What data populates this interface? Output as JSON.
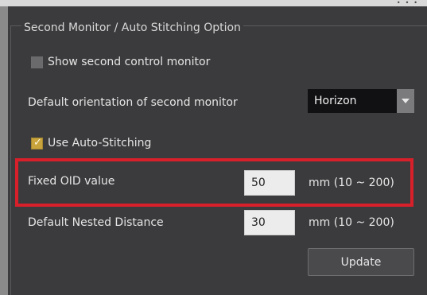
{
  "group": {
    "title": "Second Monitor / Auto Stitching Option"
  },
  "show_second_monitor": {
    "label": "Show second control monitor",
    "checked": false
  },
  "orientation": {
    "label": "Default orientation of second monitor",
    "selected": "Horizon"
  },
  "auto_stitching": {
    "label": "Use Auto-Stitching",
    "checked": true
  },
  "fixed_oid": {
    "label": "Fixed OID value",
    "value": "50",
    "unit": "mm (10 ~ 200)"
  },
  "nested_distance": {
    "label": "Default Nested Distance",
    "value": "30",
    "unit": "mm (10 ~ 200)"
  },
  "buttons": {
    "update": "Update"
  },
  "colors": {
    "panel_bg": "#3b3b3d",
    "highlight": "#d8202a",
    "checkbox_checked": "#c9a43c"
  },
  "icons": {
    "dropdown": "chevron-down-icon",
    "checkmark": "checkmark-icon"
  }
}
